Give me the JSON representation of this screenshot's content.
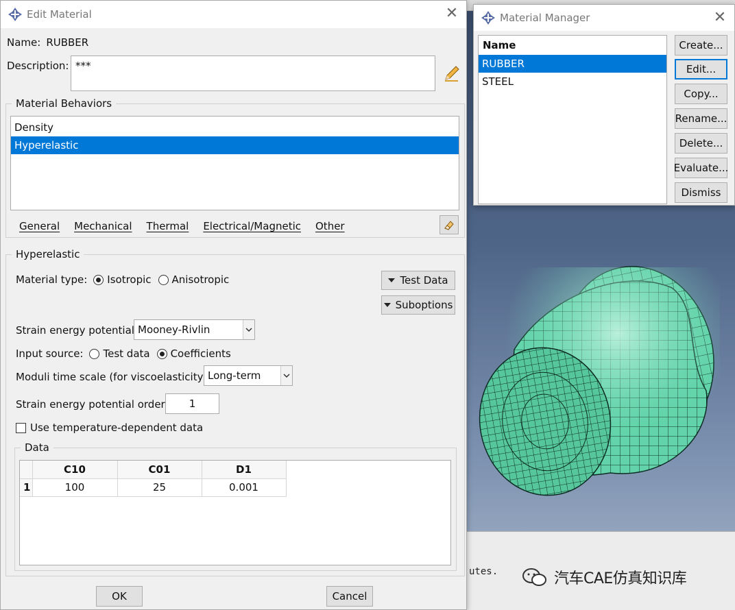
{
  "edit_material": {
    "title": "Edit Material",
    "name_label": "Name:",
    "name_value": "RUBBER",
    "description_label": "Description:",
    "description_value": "***",
    "behaviors_group": "Material Behaviors",
    "behaviors": [
      "Density",
      "Hyperelastic"
    ],
    "selected_behavior": "Hyperelastic",
    "menu": [
      "General",
      "Mechanical",
      "Thermal",
      "Electrical/Magnetic",
      "Other"
    ],
    "hyperelastic_group": "Hyperelastic",
    "material_type_label": "Material type:",
    "material_type_options": [
      "Isotropic",
      "Anisotropic"
    ],
    "material_type_selected": "Isotropic",
    "test_data_button": "Test Data",
    "suboptions_button": "Suboptions",
    "strain_energy_label": "Strain energy potential:",
    "strain_energy_value": "Mooney-Rivlin",
    "input_source_label": "Input source:",
    "input_source_options": [
      "Test data",
      "Coefficients"
    ],
    "input_source_selected": "Coefficients",
    "moduli_label": "Moduli time scale (for viscoelasticity):",
    "moduli_value": "Long-term",
    "order_label": "Strain energy potential order:",
    "order_value": "1",
    "temperature_label": "Use temperature-dependent data",
    "temperature_checked": false,
    "data_group": "Data",
    "table": {
      "columns": [
        "C10",
        "C01",
        "D1"
      ],
      "rows": [
        {
          "index": "1",
          "cells": [
            "100",
            "25",
            "0.001"
          ]
        }
      ]
    },
    "ok_button": "OK",
    "cancel_button": "Cancel"
  },
  "material_manager": {
    "title": "Material Manager",
    "list_header": "Name",
    "materials": [
      "RUBBER",
      "STEEL"
    ],
    "selected_material": "RUBBER",
    "buttons": {
      "create": "Create...",
      "edit": "Edit...",
      "copy": "Copy...",
      "rename": "Rename...",
      "delete": "Delete...",
      "evaluate": "Evaluate...",
      "dismiss": "Dismiss"
    }
  },
  "background": {
    "console_text": "utes.",
    "watermark": "汽车CAE仿真知识库",
    "mesh_color": "#5fd3a8"
  },
  "icons": {
    "app": "abaqus-cross-icon",
    "close": "close-icon",
    "pencil": "pencil-icon",
    "eraser": "eraser-icon"
  }
}
